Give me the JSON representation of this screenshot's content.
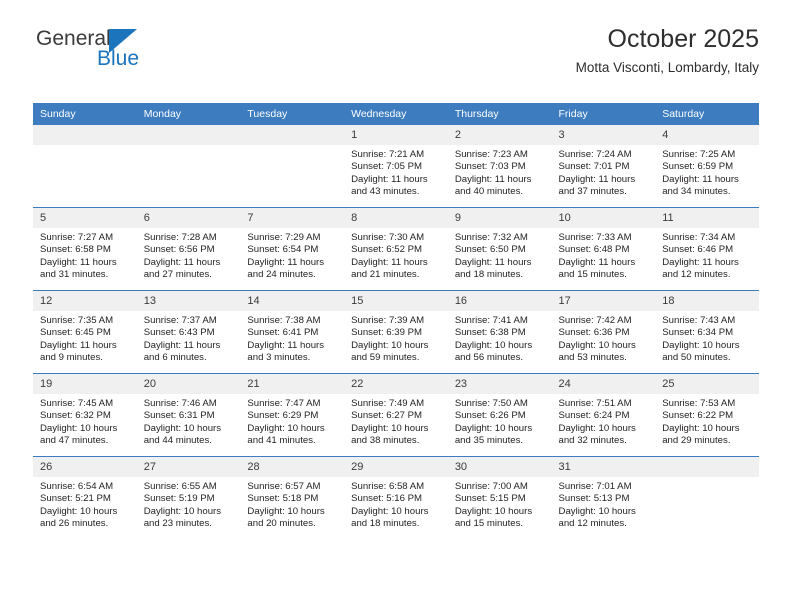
{
  "brand": {
    "name_top": "General",
    "name_bottom": "Blue",
    "triangle_color": "#1b74bc"
  },
  "header": {
    "title": "October 2025",
    "subtitle": "Motta Visconti, Lombardy, Italy"
  },
  "theme": {
    "header_blue": "#3c7cbf",
    "daynum_bg": "#f0f0f0",
    "text": "#231f20"
  },
  "weekday_headers": [
    "Sunday",
    "Monday",
    "Tuesday",
    "Wednesday",
    "Thursday",
    "Friday",
    "Saturday"
  ],
  "weeks": [
    [
      {
        "day": "",
        "empty": true,
        "sunrise": "",
        "sunset": "",
        "daylight_1": "",
        "daylight_2": ""
      },
      {
        "day": "",
        "empty": true,
        "sunrise": "",
        "sunset": "",
        "daylight_1": "",
        "daylight_2": ""
      },
      {
        "day": "",
        "empty": true,
        "sunrise": "",
        "sunset": "",
        "daylight_1": "",
        "daylight_2": ""
      },
      {
        "day": "1",
        "sunrise": "Sunrise: 7:21 AM",
        "sunset": "Sunset: 7:05 PM",
        "daylight_1": "Daylight: 11 hours",
        "daylight_2": "and 43 minutes."
      },
      {
        "day": "2",
        "sunrise": "Sunrise: 7:23 AM",
        "sunset": "Sunset: 7:03 PM",
        "daylight_1": "Daylight: 11 hours",
        "daylight_2": "and 40 minutes."
      },
      {
        "day": "3",
        "sunrise": "Sunrise: 7:24 AM",
        "sunset": "Sunset: 7:01 PM",
        "daylight_1": "Daylight: 11 hours",
        "daylight_2": "and 37 minutes."
      },
      {
        "day": "4",
        "sunrise": "Sunrise: 7:25 AM",
        "sunset": "Sunset: 6:59 PM",
        "daylight_1": "Daylight: 11 hours",
        "daylight_2": "and 34 minutes."
      }
    ],
    [
      {
        "day": "5",
        "sunrise": "Sunrise: 7:27 AM",
        "sunset": "Sunset: 6:58 PM",
        "daylight_1": "Daylight: 11 hours",
        "daylight_2": "and 31 minutes."
      },
      {
        "day": "6",
        "sunrise": "Sunrise: 7:28 AM",
        "sunset": "Sunset: 6:56 PM",
        "daylight_1": "Daylight: 11 hours",
        "daylight_2": "and 27 minutes."
      },
      {
        "day": "7",
        "sunrise": "Sunrise: 7:29 AM",
        "sunset": "Sunset: 6:54 PM",
        "daylight_1": "Daylight: 11 hours",
        "daylight_2": "and 24 minutes."
      },
      {
        "day": "8",
        "sunrise": "Sunrise: 7:30 AM",
        "sunset": "Sunset: 6:52 PM",
        "daylight_1": "Daylight: 11 hours",
        "daylight_2": "and 21 minutes."
      },
      {
        "day": "9",
        "sunrise": "Sunrise: 7:32 AM",
        "sunset": "Sunset: 6:50 PM",
        "daylight_1": "Daylight: 11 hours",
        "daylight_2": "and 18 minutes."
      },
      {
        "day": "10",
        "sunrise": "Sunrise: 7:33 AM",
        "sunset": "Sunset: 6:48 PM",
        "daylight_1": "Daylight: 11 hours",
        "daylight_2": "and 15 minutes."
      },
      {
        "day": "11",
        "sunrise": "Sunrise: 7:34 AM",
        "sunset": "Sunset: 6:46 PM",
        "daylight_1": "Daylight: 11 hours",
        "daylight_2": "and 12 minutes."
      }
    ],
    [
      {
        "day": "12",
        "sunrise": "Sunrise: 7:35 AM",
        "sunset": "Sunset: 6:45 PM",
        "daylight_1": "Daylight: 11 hours",
        "daylight_2": "and 9 minutes."
      },
      {
        "day": "13",
        "sunrise": "Sunrise: 7:37 AM",
        "sunset": "Sunset: 6:43 PM",
        "daylight_1": "Daylight: 11 hours",
        "daylight_2": "and 6 minutes."
      },
      {
        "day": "14",
        "sunrise": "Sunrise: 7:38 AM",
        "sunset": "Sunset: 6:41 PM",
        "daylight_1": "Daylight: 11 hours",
        "daylight_2": "and 3 minutes."
      },
      {
        "day": "15",
        "sunrise": "Sunrise: 7:39 AM",
        "sunset": "Sunset: 6:39 PM",
        "daylight_1": "Daylight: 10 hours",
        "daylight_2": "and 59 minutes."
      },
      {
        "day": "16",
        "sunrise": "Sunrise: 7:41 AM",
        "sunset": "Sunset: 6:38 PM",
        "daylight_1": "Daylight: 10 hours",
        "daylight_2": "and 56 minutes."
      },
      {
        "day": "17",
        "sunrise": "Sunrise: 7:42 AM",
        "sunset": "Sunset: 6:36 PM",
        "daylight_1": "Daylight: 10 hours",
        "daylight_2": "and 53 minutes."
      },
      {
        "day": "18",
        "sunrise": "Sunrise: 7:43 AM",
        "sunset": "Sunset: 6:34 PM",
        "daylight_1": "Daylight: 10 hours",
        "daylight_2": "and 50 minutes."
      }
    ],
    [
      {
        "day": "19",
        "sunrise": "Sunrise: 7:45 AM",
        "sunset": "Sunset: 6:32 PM",
        "daylight_1": "Daylight: 10 hours",
        "daylight_2": "and 47 minutes."
      },
      {
        "day": "20",
        "sunrise": "Sunrise: 7:46 AM",
        "sunset": "Sunset: 6:31 PM",
        "daylight_1": "Daylight: 10 hours",
        "daylight_2": "and 44 minutes."
      },
      {
        "day": "21",
        "sunrise": "Sunrise: 7:47 AM",
        "sunset": "Sunset: 6:29 PM",
        "daylight_1": "Daylight: 10 hours",
        "daylight_2": "and 41 minutes."
      },
      {
        "day": "22",
        "sunrise": "Sunrise: 7:49 AM",
        "sunset": "Sunset: 6:27 PM",
        "daylight_1": "Daylight: 10 hours",
        "daylight_2": "and 38 minutes."
      },
      {
        "day": "23",
        "sunrise": "Sunrise: 7:50 AM",
        "sunset": "Sunset: 6:26 PM",
        "daylight_1": "Daylight: 10 hours",
        "daylight_2": "and 35 minutes."
      },
      {
        "day": "24",
        "sunrise": "Sunrise: 7:51 AM",
        "sunset": "Sunset: 6:24 PM",
        "daylight_1": "Daylight: 10 hours",
        "daylight_2": "and 32 minutes."
      },
      {
        "day": "25",
        "sunrise": "Sunrise: 7:53 AM",
        "sunset": "Sunset: 6:22 PM",
        "daylight_1": "Daylight: 10 hours",
        "daylight_2": "and 29 minutes."
      }
    ],
    [
      {
        "day": "26",
        "sunrise": "Sunrise: 6:54 AM",
        "sunset": "Sunset: 5:21 PM",
        "daylight_1": "Daylight: 10 hours",
        "daylight_2": "and 26 minutes."
      },
      {
        "day": "27",
        "sunrise": "Sunrise: 6:55 AM",
        "sunset": "Sunset: 5:19 PM",
        "daylight_1": "Daylight: 10 hours",
        "daylight_2": "and 23 minutes."
      },
      {
        "day": "28",
        "sunrise": "Sunrise: 6:57 AM",
        "sunset": "Sunset: 5:18 PM",
        "daylight_1": "Daylight: 10 hours",
        "daylight_2": "and 20 minutes."
      },
      {
        "day": "29",
        "sunrise": "Sunrise: 6:58 AM",
        "sunset": "Sunset: 5:16 PM",
        "daylight_1": "Daylight: 10 hours",
        "daylight_2": "and 18 minutes."
      },
      {
        "day": "30",
        "sunrise": "Sunrise: 7:00 AM",
        "sunset": "Sunset: 5:15 PM",
        "daylight_1": "Daylight: 10 hours",
        "daylight_2": "and 15 minutes."
      },
      {
        "day": "31",
        "sunrise": "Sunrise: 7:01 AM",
        "sunset": "Sunset: 5:13 PM",
        "daylight_1": "Daylight: 10 hours",
        "daylight_2": "and 12 minutes."
      },
      {
        "day": "",
        "empty": true,
        "sunrise": "",
        "sunset": "",
        "daylight_1": "",
        "daylight_2": ""
      }
    ]
  ]
}
